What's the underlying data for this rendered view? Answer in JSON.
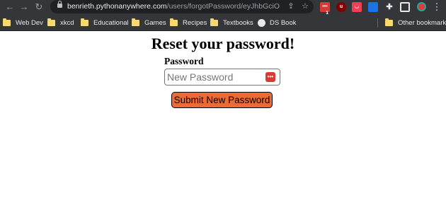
{
  "browser": {
    "url_host": "benrieth.pythonanywhere.com",
    "url_path": "/users/forgotPassword/eyJhbGciOiJI...",
    "nav": {
      "back_icon": "←",
      "forward_icon": "→",
      "reload_icon": "↻"
    },
    "extensions": [
      {
        "name": "ext-red-icon",
        "color": "#d93a32",
        "badge": "1"
      },
      {
        "name": "ublock-icon",
        "color": "#800000"
      },
      {
        "name": "pocket-icon",
        "color": "#ef4056"
      },
      {
        "name": "extension-blue-icon",
        "color": "#1a73e8"
      }
    ]
  },
  "bookmarks": {
    "items": [
      {
        "label": "Web Dev"
      },
      {
        "label": "xkcd"
      },
      {
        "label": "Educational"
      },
      {
        "label": "Games"
      },
      {
        "label": "Recipes"
      },
      {
        "label": "Textbooks"
      },
      {
        "label": "DS Book"
      }
    ],
    "other": "Other bookmarks"
  },
  "page": {
    "title": "Reset your password!",
    "password_label": "Password",
    "password_placeholder": "New Password",
    "password_value": "",
    "submit_label": "Submit New Password",
    "colors": {
      "submit_bg": "#ed6a35",
      "password_manager_icon": "#d93a32"
    }
  }
}
